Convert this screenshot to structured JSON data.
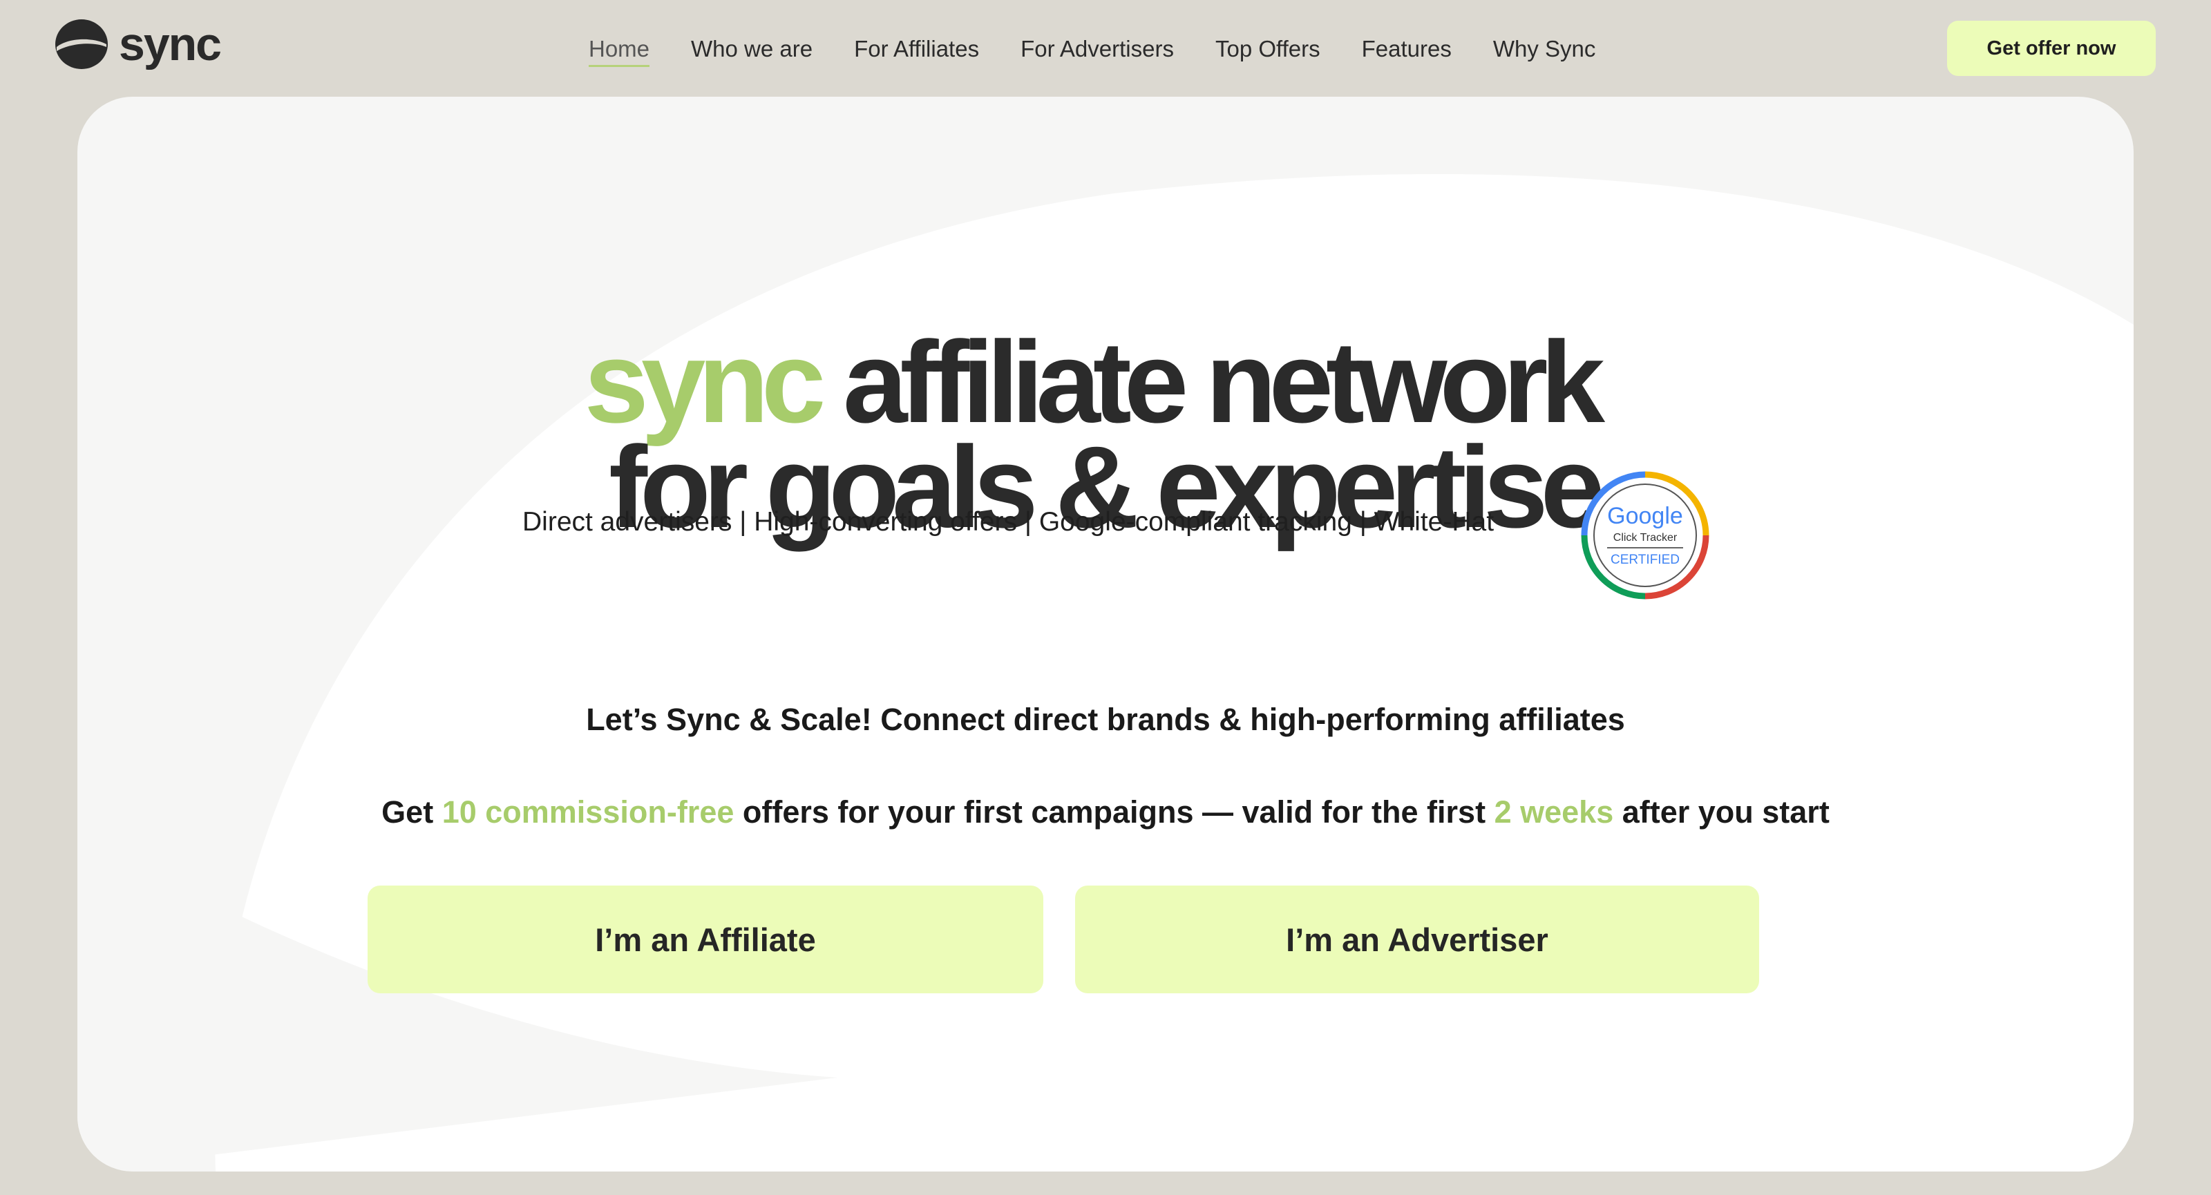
{
  "brand": {
    "name": "sync",
    "logo_icon": "sync-logo-icon"
  },
  "nav": {
    "items": [
      {
        "label": "Home",
        "active": true
      },
      {
        "label": "Who we are"
      },
      {
        "label": "For Affiliates"
      },
      {
        "label": "For Advertisers"
      },
      {
        "label": "Top Offers"
      },
      {
        "label": "Features"
      },
      {
        "label": "Why Sync"
      }
    ]
  },
  "header": {
    "cta_label": "Get offer now"
  },
  "hero": {
    "headline_accent": "sync",
    "headline_line1": " affiliate network",
    "headline_line2": "for goals & expertise",
    "features": "Direct advertisers | High-converting offers | Google-compliant tracking | White-Hat",
    "badge": {
      "line1": "Google",
      "line2": "Click Tracker",
      "line3": "CERTIFIED"
    },
    "tagline": "Let’s Sync & Scale! Connect direct brands & high-performing affiliates",
    "promo": {
      "p1": "Get ",
      "h1": "10 commission-free",
      "p2": " offers for your first campaigns — valid for the first ",
      "h2": "2 weeks",
      "p3": " after you start"
    },
    "buttons": {
      "affiliate": "I’m an Affiliate",
      "advertiser": "I’m an Advertiser"
    }
  },
  "colors": {
    "accent": "#a7cc6b",
    "cta_bg": "#ecfcb8",
    "page_bg": "#dcd9d1",
    "card_bg": "#f6f6f5"
  }
}
